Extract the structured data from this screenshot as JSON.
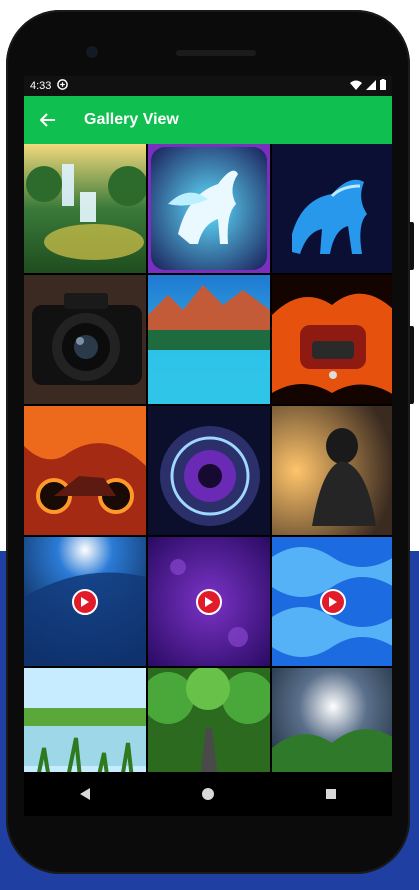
{
  "status": {
    "time": "4:33"
  },
  "appbar": {
    "title": "Gallery View"
  },
  "gallery": {
    "items": [
      {
        "name": "waterfall",
        "type": "image"
      },
      {
        "name": "unicorn",
        "type": "image"
      },
      {
        "name": "flame-horse",
        "type": "image"
      },
      {
        "name": "camera",
        "type": "image"
      },
      {
        "name": "mountain-lake",
        "type": "image"
      },
      {
        "name": "fire-car",
        "type": "image"
      },
      {
        "name": "fire-motorcycle",
        "type": "image"
      },
      {
        "name": "lens-eye",
        "type": "image"
      },
      {
        "name": "hooded-figure",
        "type": "image"
      },
      {
        "name": "earth-sunrise",
        "type": "video"
      },
      {
        "name": "purple-texture",
        "type": "video"
      },
      {
        "name": "blue-waves",
        "type": "video"
      },
      {
        "name": "grass-lake",
        "type": "image"
      },
      {
        "name": "tree-road",
        "type": "image"
      },
      {
        "name": "green-valley",
        "type": "image"
      }
    ]
  },
  "colors": {
    "appbar": "#0fbf4f",
    "play": "#e21b2a"
  }
}
